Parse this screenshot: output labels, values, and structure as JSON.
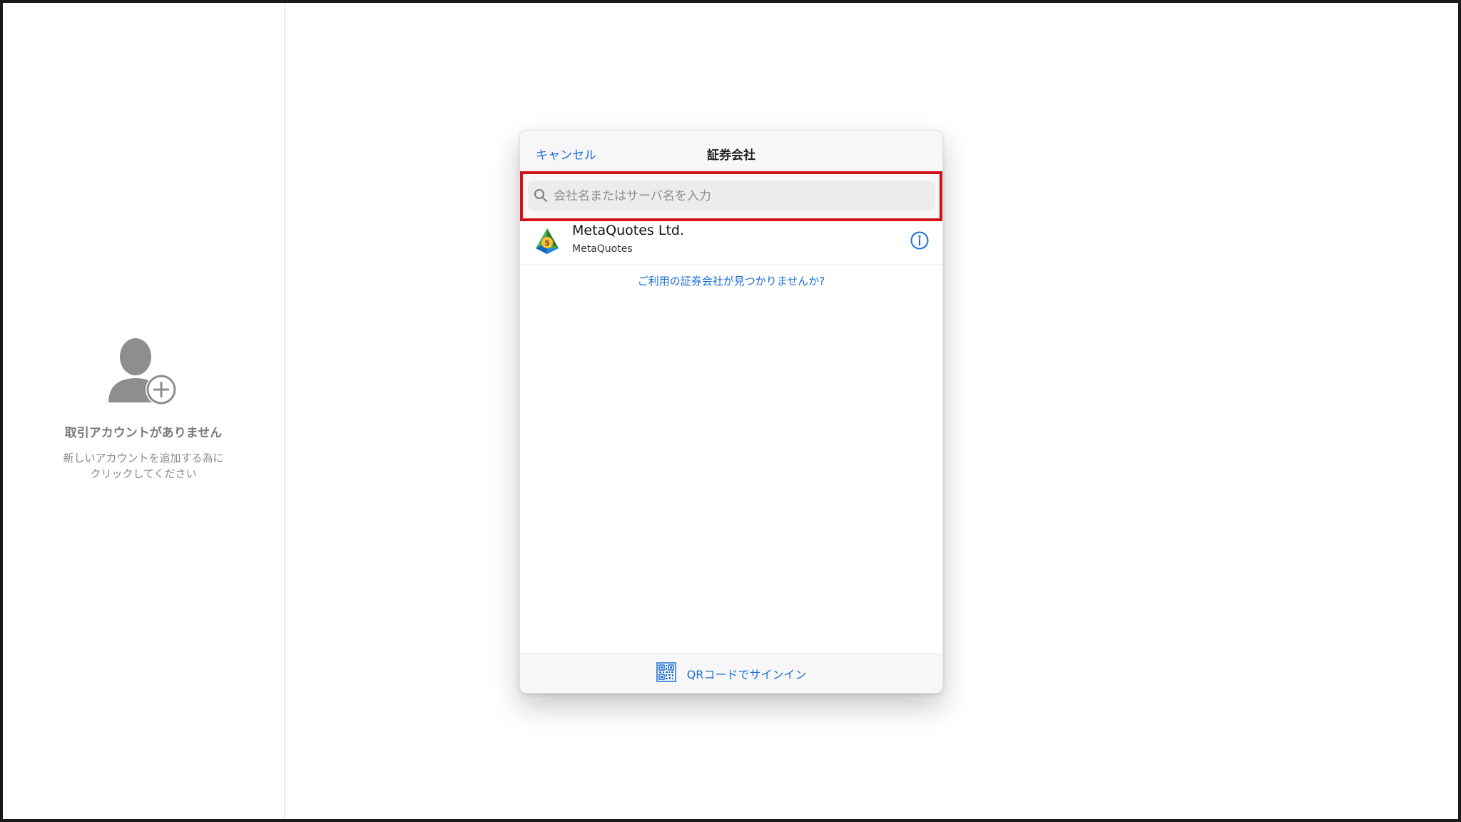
{
  "sidebar": {
    "empty_title": "取引アカウントがありません",
    "empty_subtitle_line1": "新しいアカウントを追加する為に",
    "empty_subtitle_line2": "クリックしてください",
    "icon": "add-user-icon"
  },
  "dialog": {
    "title": "証券会社",
    "cancel_label": "キャンセル",
    "search": {
      "placeholder": "会社名またはサーバ名を入力",
      "value": "",
      "icon": "search-icon"
    },
    "brokers": [
      {
        "name": "MetaQuotes Ltd.",
        "server": "MetaQuotes",
        "logo": "metatrader5-logo",
        "info_icon": "info-icon"
      }
    ],
    "not_found_link": "ご利用の証券会社が見つかりませんか?",
    "footer": {
      "qr_signin_label": "QRコードでサインイン",
      "icon": "qr-code-icon"
    }
  },
  "colors": {
    "accent": "#1c6fd6",
    "highlight_border": "#d0121b",
    "muted_text": "#7a7a7a"
  }
}
